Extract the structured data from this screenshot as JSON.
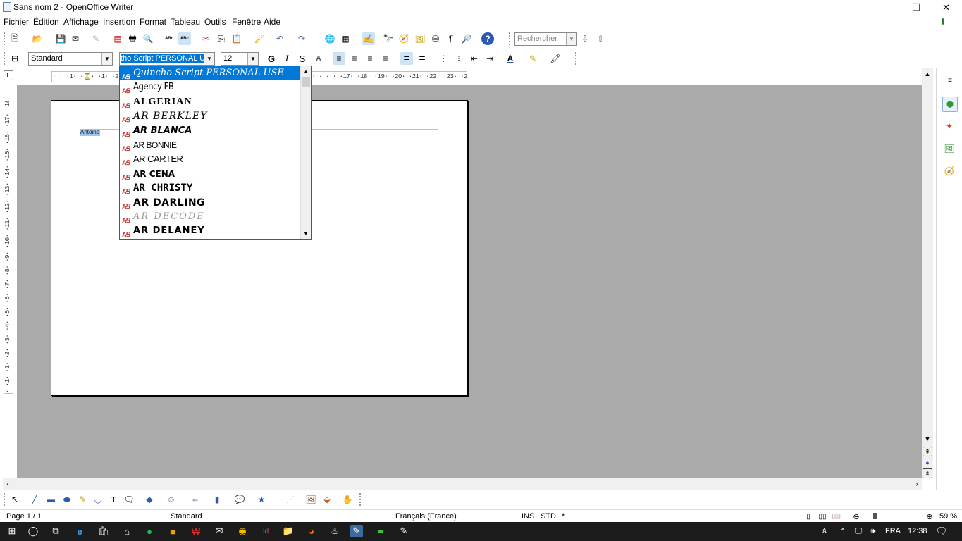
{
  "window": {
    "title": "Sans nom 2 - OpenOffice Writer",
    "minimize": "—",
    "restore": "❐",
    "close": "✕"
  },
  "menu": [
    "Fichier",
    "Édition",
    "Affichage",
    "Insertion",
    "Format",
    "Tableau",
    "Outils",
    "Fenêtre",
    "Aide"
  ],
  "toolbar": {
    "search_placeholder": "Rechercher",
    "style_value": "Standard",
    "font_value": "tho Script PERSONAL USE",
    "size_value": "12"
  },
  "ruler": {
    "horizontal": "· · ·1· ·⏳· ·1· ·2· · · · · · · · · · · · · · · · · · · · · · · · · · · · · · · · ·17· ·18· ·19· ·20· ·21· ·22· ·23· ·24· ·25· ·26· ·27·",
    "vertical": "· ·1· ·1· ·2· ·3· ·4· ·5· ·6· ·7· ·8· ·9· ·10· ·11· ·12· ·13· ·14· ·15· ·16· ·17· ·18·"
  },
  "document": {
    "selected_text": "Antoine"
  },
  "font_list": [
    {
      "name": "Quincho Script PERSONAL USE",
      "selected": true
    },
    {
      "name": "Agency FB",
      "selected": false
    },
    {
      "name": "ALGERIAN",
      "selected": false
    },
    {
      "name": "AR BERKLEY",
      "selected": false
    },
    {
      "name": "AR BLANCA",
      "selected": false
    },
    {
      "name": "AR BONNIE",
      "selected": false
    },
    {
      "name": "AR CARTER",
      "selected": false
    },
    {
      "name": "AR CENA",
      "selected": false
    },
    {
      "name": "AR CHRISTY",
      "selected": false
    },
    {
      "name": "AR DARLING",
      "selected": false
    },
    {
      "name": "AR DECODE",
      "selected": false
    },
    {
      "name": "AR DELANEY",
      "selected": false
    }
  ],
  "font_icon_label": "A⁄Ꞩ",
  "status": {
    "page": "Page 1 / 1",
    "style": "Standard",
    "language": "Français (France)",
    "ins": "INS",
    "std": "STD",
    "star": "*",
    "zoom": "59 %"
  },
  "taskbar": {
    "language": "FRA",
    "time": "12:38"
  },
  "colors": {
    "selection": "#0078d7",
    "workspace": "#aaaaaa",
    "taskbar": "#1c1c1c"
  }
}
